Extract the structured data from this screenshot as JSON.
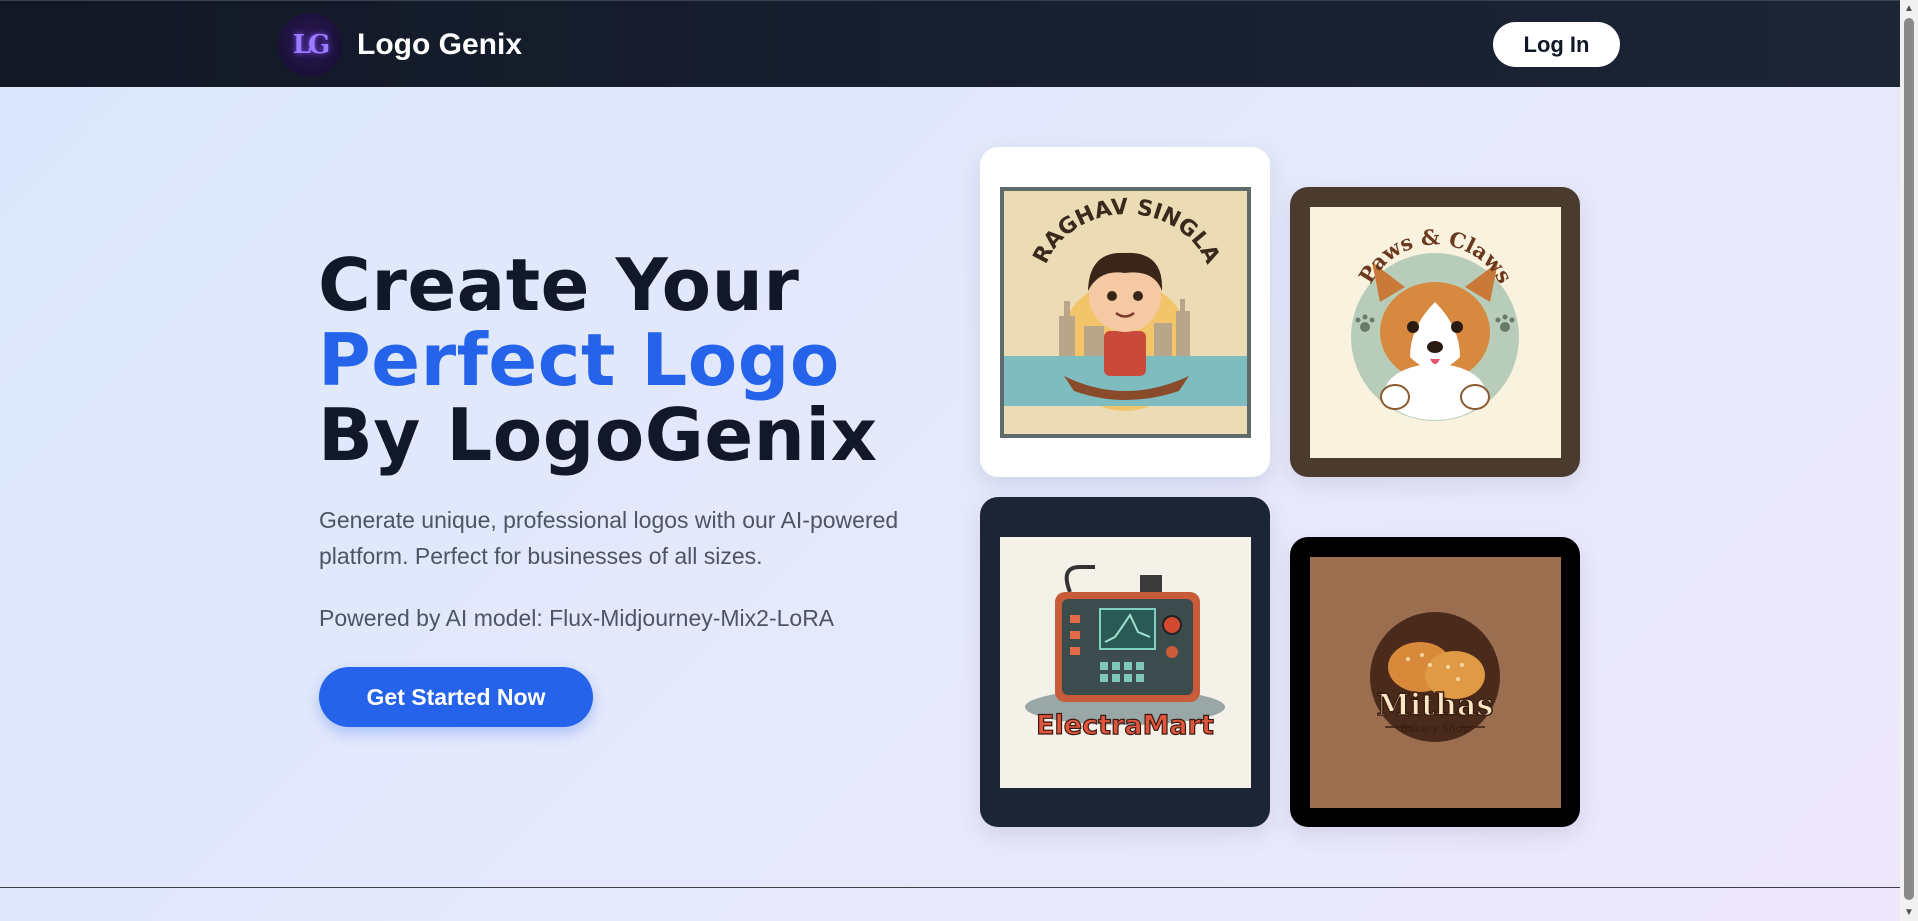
{
  "nav": {
    "logo_mark": "LG",
    "brand": "Logo Genix",
    "login": "Log In"
  },
  "hero": {
    "title_line1": "Create Your",
    "title_line2": "Perfect Logo",
    "title_line3": "By LogoGenix",
    "description": "Generate unique, professional logos with our AI-powered platform. Perfect for businesses of all sizes.",
    "model": "Powered by AI model: Flux-Midjourney-Mix2-LoRA",
    "cta": "Get Started Now"
  },
  "gallery": [
    {
      "text": "RAGHAV SINGLA"
    },
    {
      "text": "Paws & Claws"
    },
    {
      "text": "ElectraMart"
    },
    {
      "text": "Mithas",
      "subtext": "Bakery Shop"
    }
  ],
  "colors": {
    "nav_bg": "#121826",
    "accent": "#2563eb",
    "heading": "#111827",
    "body_text": "#4b5563"
  }
}
